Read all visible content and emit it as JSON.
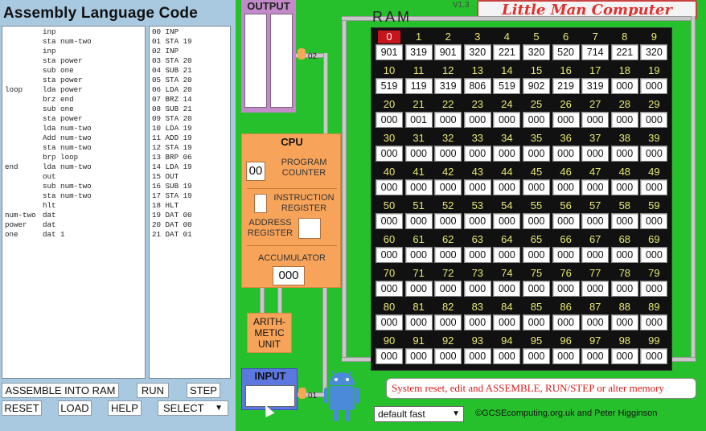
{
  "app": {
    "brand": "Little Man Computer",
    "version": "V1.3",
    "credit": "©GCSEcomputing.org.uk and Peter Higginson"
  },
  "editor": {
    "title": "Assembly Language Code",
    "source": [
      {
        "label": "",
        "op": "inp"
      },
      {
        "label": "",
        "op": "sta num-two"
      },
      {
        "label": "",
        "op": "inp"
      },
      {
        "label": "",
        "op": "sta power"
      },
      {
        "label": "",
        "op": "sub one"
      },
      {
        "label": "",
        "op": "sta power"
      },
      {
        "label": "loop",
        "op": "lda power"
      },
      {
        "label": "",
        "op": "brz end"
      },
      {
        "label": "",
        "op": "sub one"
      },
      {
        "label": "",
        "op": "sta power"
      },
      {
        "label": "",
        "op": "lda num-two"
      },
      {
        "label": "",
        "op": "Add num-two"
      },
      {
        "label": "",
        "op": "sta num-two"
      },
      {
        "label": "",
        "op": "brp loop"
      },
      {
        "label": "end",
        "op": "lda num-two"
      },
      {
        "label": "",
        "op": "out"
      },
      {
        "label": "",
        "op": "sub num-two"
      },
      {
        "label": "",
        "op": "sta num-two"
      },
      {
        "label": "",
        "op": "hlt"
      },
      {
        "label": "num-two",
        "op": "dat"
      },
      {
        "label": "power",
        "op": "dat"
      },
      {
        "label": "one",
        "op": "dat 1"
      }
    ],
    "object": [
      "00 INP",
      "01 STA 19",
      "02 INP",
      "03 STA 20",
      "04 SUB 21",
      "05 STA 20",
      "06 LDA 20",
      "07 BRZ 14",
      "08 SUB 21",
      "09 STA 20",
      "10 LDA 19",
      "11 ADD 19",
      "12 STA 19",
      "13 BRP 06",
      "14 LDA 19",
      "15 OUT",
      "16 SUB 19",
      "17 STA 19",
      "18 HLT",
      "19 DAT 00",
      "20 DAT 00",
      "21 DAT 01"
    ]
  },
  "buttons": {
    "assemble": "ASSEMBLE INTO RAM",
    "run": "RUN",
    "step": "STEP",
    "reset": "RESET",
    "load": "LOAD",
    "help": "HELP",
    "select": "SELECT"
  },
  "output": {
    "title": "OUTPUT",
    "port": "02"
  },
  "input": {
    "title": "INPUT",
    "port": "01"
  },
  "cpu": {
    "title": "CPU",
    "pc_label": "PROGRAM COUNTER",
    "pc_value": "00",
    "ir_label": "INSTRUCTION REGISTER",
    "ir_value": "",
    "ar_label": "ADDRESS REGISTER",
    "ar_value": "",
    "acc_label": "ACCUMULATOR",
    "acc_value": "000"
  },
  "alu": {
    "label": "ARITH- METIC UNIT"
  },
  "ram": {
    "title": "RAM",
    "active_address": 0,
    "values": [
      "901",
      "319",
      "901",
      "320",
      "221",
      "320",
      "520",
      "714",
      "221",
      "320",
      "519",
      "119",
      "319",
      "806",
      "519",
      "902",
      "219",
      "319",
      "000",
      "000",
      "000",
      "001",
      "000",
      "000",
      "000",
      "000",
      "000",
      "000",
      "000",
      "000",
      "000",
      "000",
      "000",
      "000",
      "000",
      "000",
      "000",
      "000",
      "000",
      "000",
      "000",
      "000",
      "000",
      "000",
      "000",
      "000",
      "000",
      "000",
      "000",
      "000",
      "000",
      "000",
      "000",
      "000",
      "000",
      "000",
      "000",
      "000",
      "000",
      "000",
      "000",
      "000",
      "000",
      "000",
      "000",
      "000",
      "000",
      "000",
      "000",
      "000",
      "000",
      "000",
      "000",
      "000",
      "000",
      "000",
      "000",
      "000",
      "000",
      "000",
      "000",
      "000",
      "000",
      "000",
      "000",
      "000",
      "000",
      "000",
      "000",
      "000",
      "000",
      "000",
      "000",
      "000",
      "000",
      "000",
      "000",
      "000",
      "000",
      "000"
    ]
  },
  "speed": {
    "selected": "default fast"
  },
  "message": "System reset, edit and ASSEMBLE, RUN/STEP or alter memory",
  "colors": {
    "machine_bg": "#26c02c",
    "cpu": "#f7a45a",
    "output": "#c28ac9",
    "input": "#5c78e0",
    "active_cell": "#c8141c",
    "message_text": "#d42020"
  },
  "icons": {
    "mascot": "android-robot-icon",
    "dropdown": "chevron-down-icon"
  }
}
